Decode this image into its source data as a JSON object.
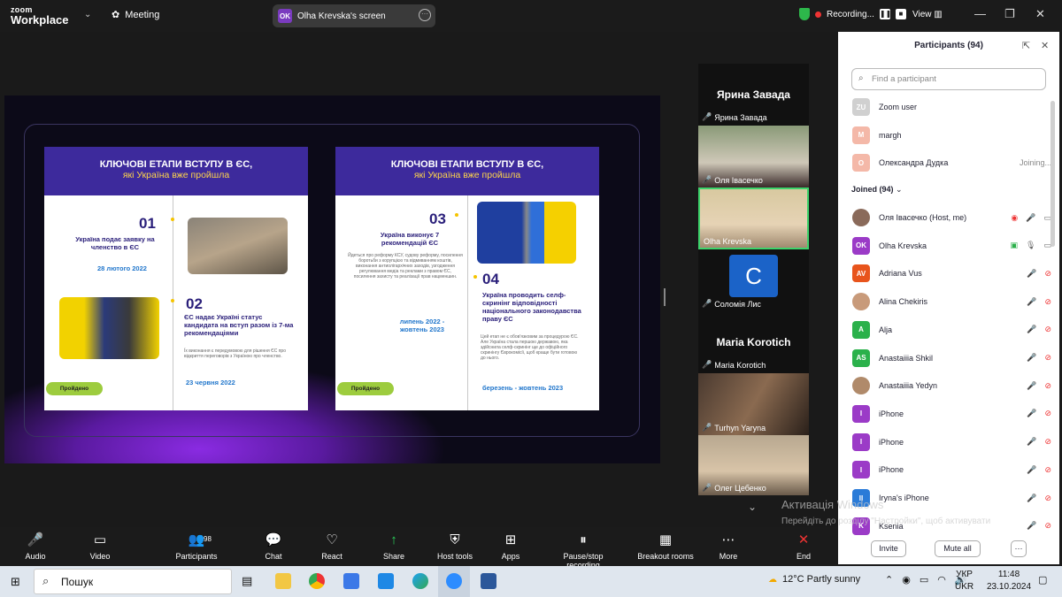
{
  "topbar": {
    "logo_line1": "zoom",
    "logo_line2": "Workplace",
    "meeting": "Meeting",
    "screen_label": "Olha Krevska's screen",
    "screen_initials": "OK",
    "recording": "Recording...",
    "view": "View"
  },
  "slides": {
    "left": {
      "title": "КЛЮЧОВІ ЕТАПИ ВСТУПУ В ЄС,",
      "subtitle": "які Україна вже пройшла",
      "n1": "01",
      "t1": "Україна подає заявку на членство в ЄС",
      "d1": "28 лютого 2022",
      "n2": "02",
      "t2": "ЄС надає Україні статус кандидата на вступ разом із 7-ма рекомендаціями",
      "s2": "Їх виконання є передумовою для рішення ЄС про відкриття переговорів з Україною про членство.",
      "d2": "23 червня 2022",
      "pill": "Пройдено"
    },
    "right": {
      "title": "КЛЮЧОВІ ЕТАПИ ВСТУПУ В ЄС,",
      "subtitle": "які Україна вже пройшла",
      "n3": "03",
      "t3": "Україна виконує 7 рекомендацій ЄС",
      "s3": "Йдеться про реформу КСУ, судову реформу, посилення боротьби з корупцією та відмиванням коштів, виконання антиолігархічних заходів, узгодження регулювання медіа та реклами з правом ЄС, посилення захисту та реалізації прав нацменшин.",
      "d3": "липень 2022 - жовтень 2023",
      "n4": "04",
      "t4": "Україна проводить селф-скринінг відповідності національного законодавства праву ЄС",
      "s4": "Цей етап не є обов'язковим за процедурою ЄС. Але Україна стала першою державою, яка здійснила селф-скринінг ще до офіційного скринінгу Єврокомісії, щоб краще бути готовою до нього.",
      "d4": "березень - жовтень 2023",
      "pill": "Пройдено"
    }
  },
  "videos": [
    {
      "big": "Ярина Завада",
      "label": "Ярина Завада"
    },
    {
      "label": "Оля Івасечко"
    },
    {
      "label": "Olha Krevska"
    },
    {
      "initial": "C",
      "label": "Соломія Лис"
    },
    {
      "big": "Maria Korotich",
      "label": "Maria Korotich"
    },
    {
      "label": "Turhyn Yaryna"
    },
    {
      "label": "Олег Цебенко"
    }
  ],
  "participants": {
    "title": "Participants (94)",
    "search_placeholder": "Find a participant",
    "joined_label": "Joined (94)",
    "waiting": [
      {
        "initials": "ZU",
        "name": "Zoom user",
        "color": "#d0d0d0",
        "status": ""
      },
      {
        "initials": "M",
        "name": "margh",
        "color": "#f4b8a8",
        "status": ""
      },
      {
        "initials": "О",
        "name": "Олександра Дудка",
        "color": "#f4b8a8",
        "status": "Joining..."
      }
    ],
    "joined": [
      {
        "initials": "",
        "name": "Оля Івасечко (Host, me)",
        "color": "#8a6a5a"
      },
      {
        "initials": "OK",
        "name": "Olha Krevska",
        "color": "#9b3bc7"
      },
      {
        "initials": "AV",
        "name": "Adriana Vus",
        "color": "#e8541c"
      },
      {
        "initials": "",
        "name": "Alina Chekiris",
        "color": "#c89a7a"
      },
      {
        "initials": "A",
        "name": "Alja",
        "color": "#2bb14b"
      },
      {
        "initials": "AS",
        "name": "Anastaiiia Shkil",
        "color": "#2bb14b"
      },
      {
        "initials": "",
        "name": "Anastaiiia Yedyn",
        "color": "#b08a6a"
      },
      {
        "initials": "I",
        "name": "iPhone",
        "color": "#9b3bc7"
      },
      {
        "initials": "I",
        "name": "iPhone",
        "color": "#9b3bc7"
      },
      {
        "initials": "I",
        "name": "iPhone",
        "color": "#9b3bc7"
      },
      {
        "initials": "II",
        "name": "Iryna's iPhone",
        "color": "#2a7bd8"
      },
      {
        "initials": "K",
        "name": "Ksenia",
        "color": "#9b3bc7"
      }
    ],
    "invite": "Invite",
    "mute_all": "Mute all",
    "more": "···"
  },
  "watermark": {
    "line1": "Активація Windows",
    "line2": "Перейдіть до розділу \"Настройки\", щоб активувати Windows."
  },
  "toolbar": [
    {
      "icon": "🎤",
      "label": "Audio"
    },
    {
      "icon": "▭",
      "label": "Video"
    },
    {
      "icon": "👥",
      "label": "Participants",
      "count": "98"
    },
    {
      "icon": "💬",
      "label": "Chat"
    },
    {
      "icon": "♡",
      "label": "React"
    },
    {
      "icon": "↑",
      "label": "Share"
    },
    {
      "icon": "⛨",
      "label": "Host tools"
    },
    {
      "icon": "⊞",
      "label": "Apps"
    },
    {
      "icon": "⏸",
      "label": "Pause/stop recording"
    },
    {
      "icon": "▦",
      "label": "Breakout rooms"
    },
    {
      "icon": "⋯",
      "label": "More"
    },
    {
      "icon": "✕",
      "label": "End"
    }
  ],
  "taskbar": {
    "search": "Пошук",
    "weather": "12°C  Partly sunny",
    "lang1": "УКР",
    "lang2": "UKR",
    "time": "11:48",
    "date": "23.10.2024"
  }
}
